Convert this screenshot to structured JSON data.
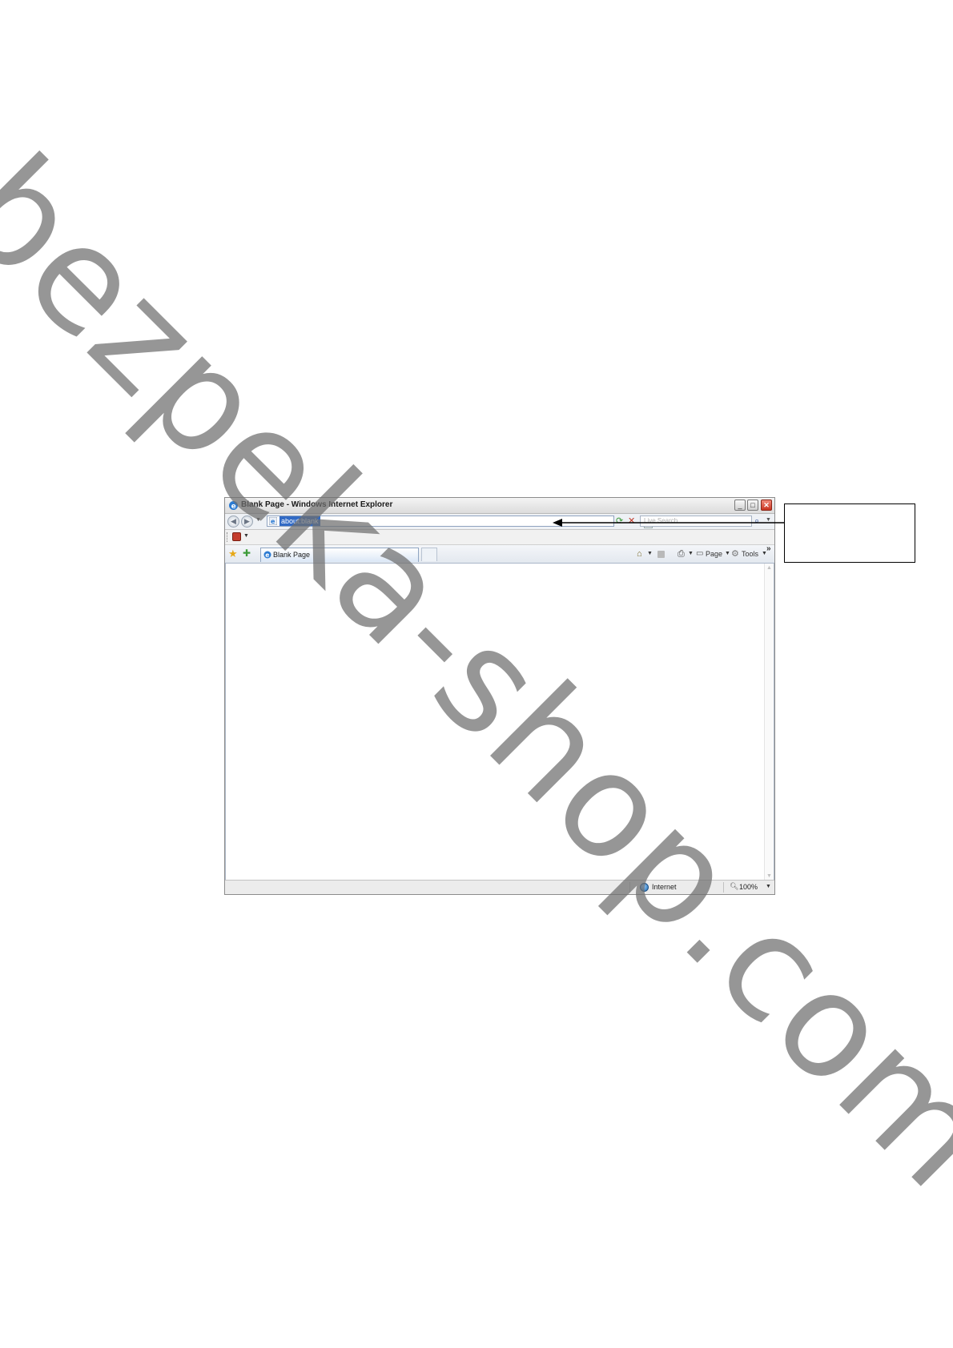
{
  "window": {
    "title": "Blank Page - Windows Internet Explorer",
    "minimize_glyph": "_",
    "maximize_glyph": "□",
    "close_glyph": "✕"
  },
  "address_bar": {
    "url": "about:blank",
    "search_placeholder": "Live Search"
  },
  "tab": {
    "label": "Blank Page"
  },
  "command_bar": {
    "page_label": "Page",
    "tools_label": "Tools",
    "chevron": "»"
  },
  "status_bar": {
    "zone": "Internet",
    "zoom": "100%"
  },
  "watermark": {
    "text": "bezpeka-shop.com"
  },
  "colors": {
    "accent": "#316ac5",
    "close_button": "#c8321f",
    "watermark": "#6f6f6f"
  }
}
